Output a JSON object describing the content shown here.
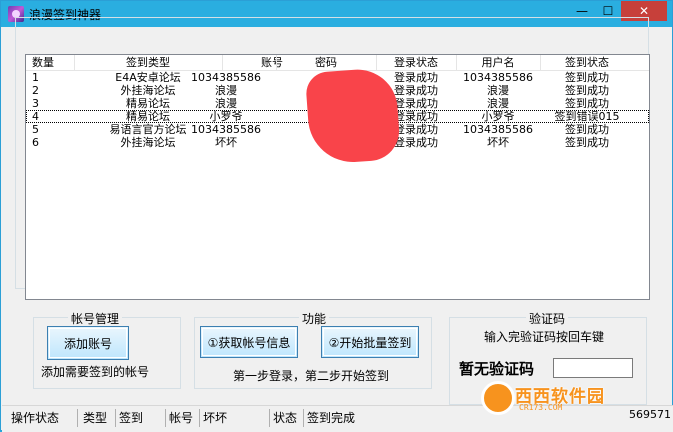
{
  "window": {
    "title": "浪漫签到神器",
    "min_label": "—",
    "max_label": "☐",
    "close_label": "✕"
  },
  "list": {
    "headers": [
      "数量",
      "签到类型",
      "账号",
      "密码",
      "登录状态",
      "用户名",
      "签到状态"
    ],
    "rows": [
      [
        "1",
        "E4A安卓论坛",
        "1034385586",
        "",
        "登录成功",
        "1034385586",
        "签到成功"
      ],
      [
        "2",
        "外挂海论坛",
        "浪漫",
        "",
        "登录成功",
        "浪漫",
        "签到成功"
      ],
      [
        "3",
        "精易论坛",
        "浪漫",
        "",
        "登录成功",
        "浪漫",
        "签到成功"
      ],
      [
        "4",
        "精易论坛",
        "小罗爷",
        "",
        "登录成功",
        "小罗爷",
        "签到错误015"
      ],
      [
        "5",
        "易语言官方论坛",
        "1034385586",
        "",
        "登录成功",
        "1034385586",
        "签到成功"
      ],
      [
        "6",
        "外挂海论坛",
        "坏坏",
        "",
        "登录成功",
        "坏坏",
        "签到成功"
      ]
    ]
  },
  "account_panel": {
    "title": "帐号管理",
    "add_button": "添加账号",
    "hint": "添加需要签到的帐号"
  },
  "function_panel": {
    "title": "功能",
    "get_info_button": "①获取帐号信息",
    "batch_sign_button": "②开始批量签到",
    "hint": "第一步登录，第二步开始签到"
  },
  "captcha_panel": {
    "title": "验证码",
    "hint": "输入完验证码按回车键",
    "status": "暂无验证码"
  },
  "statusbar": {
    "cells": [
      "操作状态",
      "类型",
      "签到",
      "帐号",
      "坏坏",
      "状态",
      "签到完成"
    ]
  },
  "watermark": {
    "text": "西西软件园",
    "sub": "CR173.COM"
  },
  "version": "569571"
}
